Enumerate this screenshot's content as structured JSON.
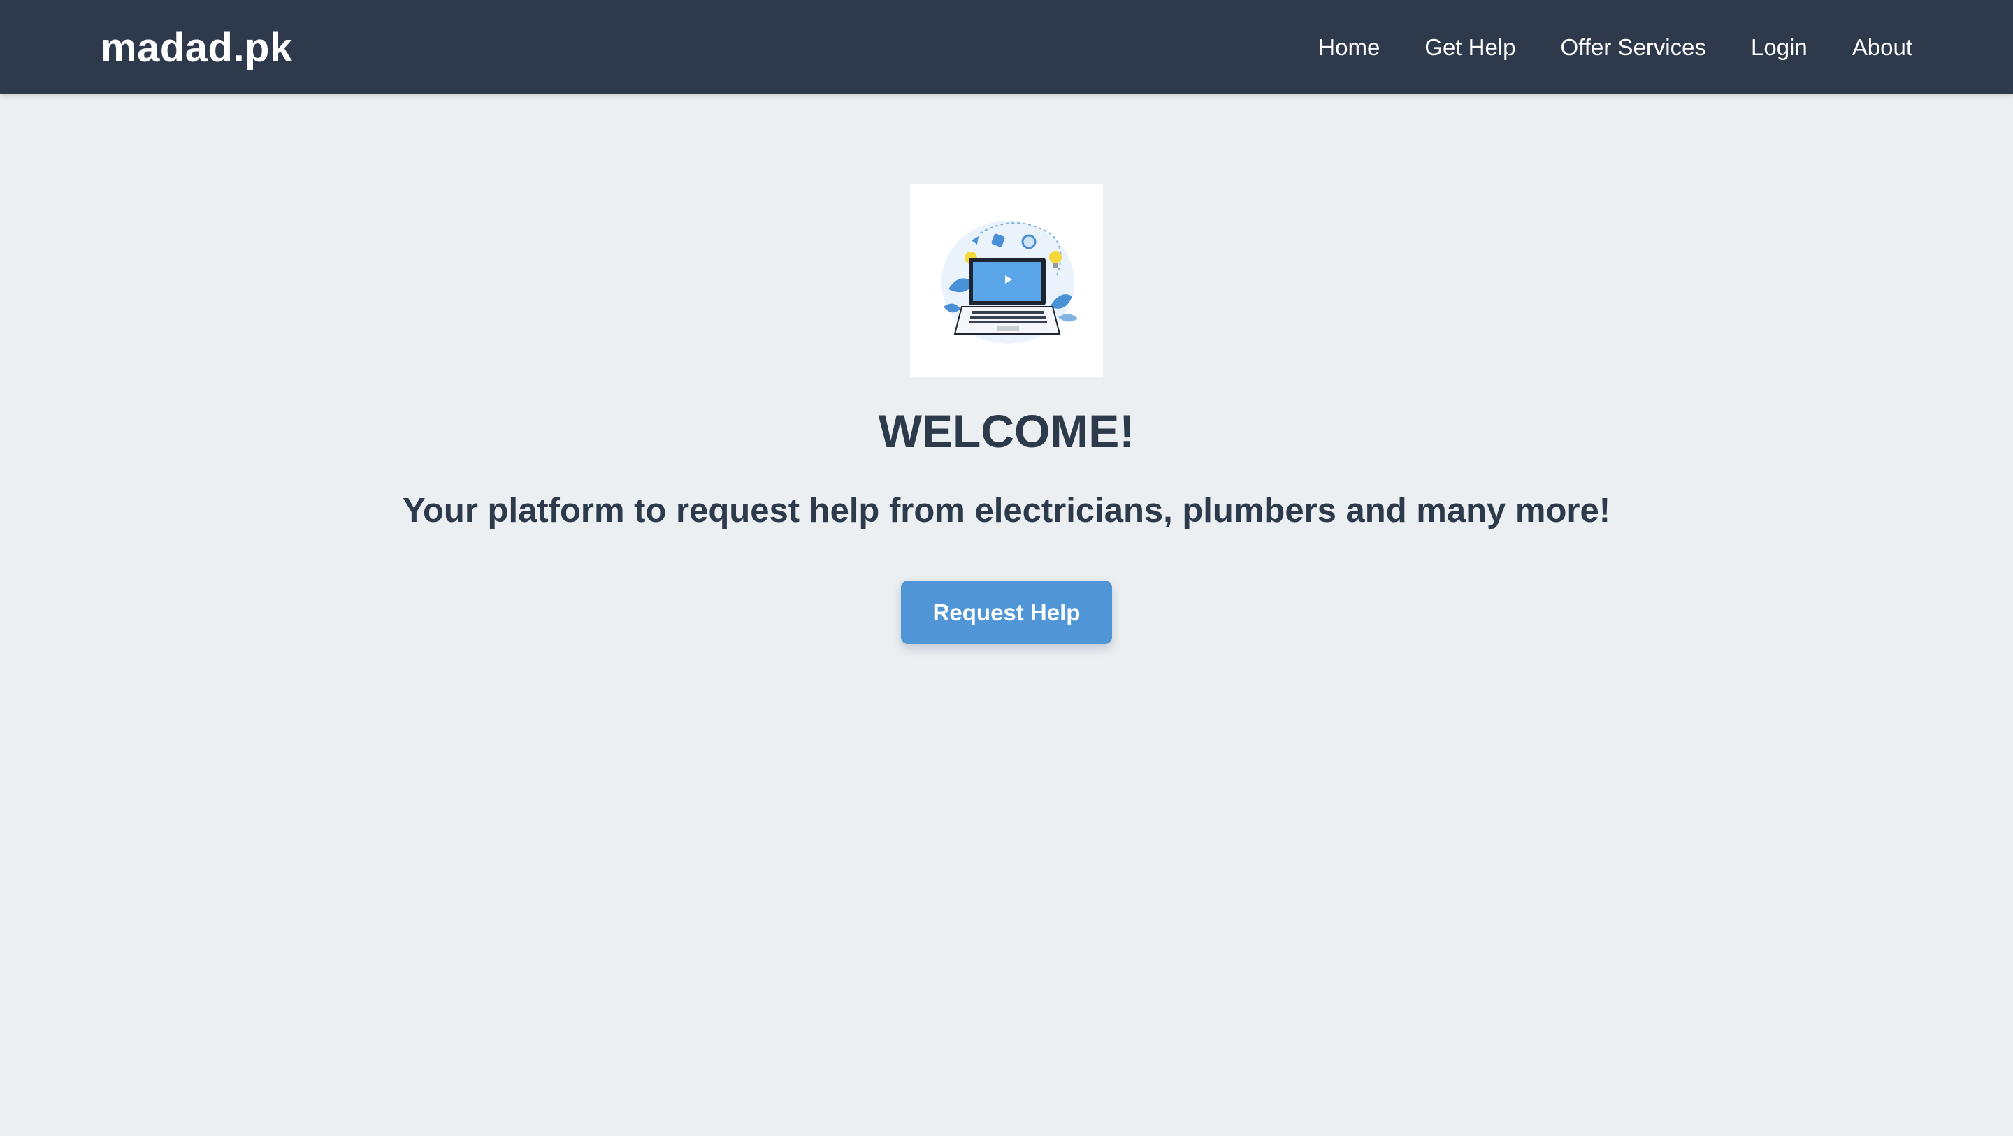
{
  "brand": {
    "name": "madad.pk"
  },
  "nav": {
    "items": [
      {
        "label": "Home"
      },
      {
        "label": "Get Help"
      },
      {
        "label": "Offer Services"
      },
      {
        "label": "Login"
      },
      {
        "label": "About"
      }
    ]
  },
  "hero": {
    "image_icon": "laptop-illustration-icon",
    "title": "WELCOME!",
    "tagline": "Your platform to request help from electricians, plumbers and many more!",
    "cta_label": "Request Help"
  },
  "colors": {
    "navbar": "#2e3a4c",
    "background": "#eceff1",
    "text": "#2d3a4b",
    "accent": "#5095d6"
  }
}
